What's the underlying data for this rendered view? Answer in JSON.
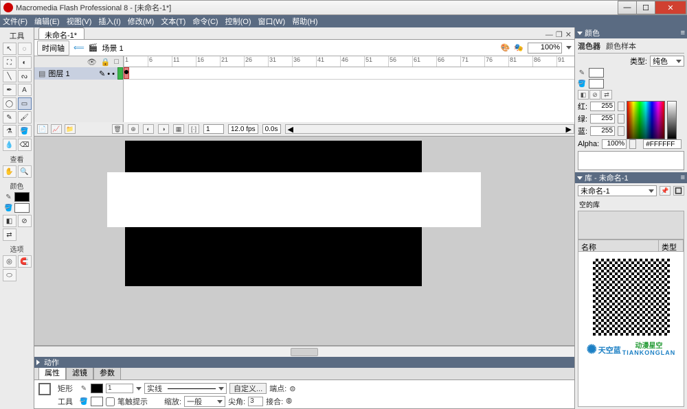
{
  "titlebar": {
    "title": "Macromedia Flash Professional 8 - [未命名-1*]"
  },
  "menubar": [
    "文件(F)",
    "编辑(E)",
    "视图(V)",
    "插入(I)",
    "修改(M)",
    "文本(T)",
    "命令(C)",
    "控制(O)",
    "窗口(W)",
    "帮助(H)"
  ],
  "tools": {
    "title": "工具",
    "view_label": "查看",
    "color_label": "颜色",
    "options_label": "选项"
  },
  "doc": {
    "tab": "未命名-1*"
  },
  "scenebar": {
    "timeline_btn": "时间轴",
    "scene_label": "场景 1",
    "zoom": "100%"
  },
  "timeline": {
    "layer_name": "图层 1",
    "frame": "1",
    "fps": "12.0 fps",
    "time": "0.0s"
  },
  "actions_panel": {
    "title": "动作"
  },
  "props": {
    "tabs": [
      "属性",
      "滤镜",
      "参数"
    ],
    "shape_label_1": "矩形",
    "shape_label_2": "工具",
    "stroke_height": "1",
    "stroke_style": "实线",
    "custom_btn": "自定义...",
    "stroke_hint": "笔触提示",
    "scale_label": "缩放:",
    "scale_value": "一般",
    "cap_label": "端点:",
    "join_label": "尖角:",
    "join_value": "3",
    "joint_label": "接合:"
  },
  "color_panel": {
    "title": "颜色",
    "tabs": [
      "混色器",
      "颜色样本"
    ],
    "type_label": "类型:",
    "type_value": "纯色",
    "red_label": "红:",
    "green_label": "绿:",
    "blue_label": "蓝:",
    "alpha_label": "Alpha:",
    "r": "255",
    "g": "255",
    "b": "255",
    "alpha": "100%",
    "hex": "#FFFFFF"
  },
  "library": {
    "title": "库 - 未命名-1",
    "doc": "未命名-1",
    "empty": "空的库",
    "col_name": "名称",
    "col_type": "类型"
  },
  "brand": {
    "name": "天空蓝",
    "sub1": "动漫星空",
    "sub2": "TIANKONGLAN"
  }
}
